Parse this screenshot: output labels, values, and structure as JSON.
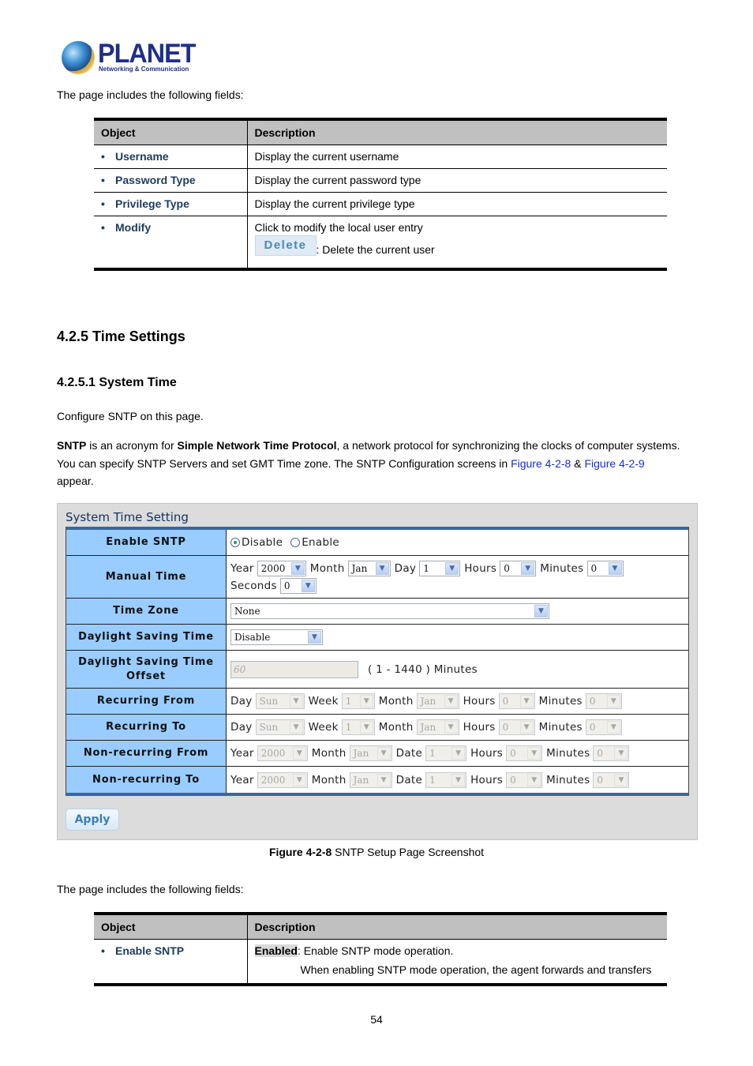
{
  "logo": {
    "brand": "PLANET",
    "tagline": "Networking & Communication"
  },
  "intro1": "The page includes the following fields:",
  "table1": {
    "headers": [
      "Object",
      "Description"
    ],
    "rows": [
      {
        "object": "Username",
        "description": "Display the current username"
      },
      {
        "object": "Password Type",
        "description": "Display the current password type"
      },
      {
        "object": "Privilege Type",
        "description": "Display the current privilege type"
      },
      {
        "object": "Modify",
        "description": "Click to modify the local user entry",
        "button_label": "Delete",
        "button_desc": ": Delete the current user"
      }
    ]
  },
  "section": {
    "h2": "4.2.5 Time Settings",
    "h3": "4.2.5.1 System Time"
  },
  "para1": "Configure SNTP on this page.",
  "para2": {
    "b1": "SNTP",
    "t1": " is an acronym for ",
    "b2": "Simple Network Time Protocol",
    "t2": ", a network protocol for synchronizing the clocks of computer systems.",
    "line2": "You can specify SNTP Servers and set GMT Time zone. The SNTP Configuration screens in ",
    "link1": "Figure 4-2-8",
    "amp": " & ",
    "link2": "Figure 4-2-9",
    "line3": "appear."
  },
  "screenshot": {
    "title": "System Time Setting",
    "enable_sntp": {
      "label": "Enable SNTP",
      "options": [
        "Disable",
        "Enable"
      ],
      "selected": "Disable"
    },
    "manual_time": {
      "label": "Manual Time",
      "year_label": "Year",
      "year": "2000",
      "month_label": "Month",
      "month": "Jan",
      "day_label": "Day",
      "day": "1",
      "hours_label": "Hours",
      "hours": "0",
      "minutes_label": "Minutes",
      "minutes": "0",
      "seconds_label": "Seconds",
      "seconds": "0"
    },
    "time_zone": {
      "label": "Time Zone",
      "value": "None"
    },
    "dst": {
      "label": "Daylight Saving Time",
      "value": "Disable"
    },
    "dst_offset": {
      "label_line1": "Daylight Saving Time",
      "label_line2": "Offset",
      "value": "60",
      "hint": "( 1 - 1440 ) Minutes"
    },
    "recurring_from": {
      "label": "Recurring From",
      "day_label": "Day",
      "day": "Sun",
      "week_label": "Week",
      "week": "1",
      "month_label": "Month",
      "month": "Jan",
      "hours_label": "Hours",
      "hours": "0",
      "minutes_label": "Minutes",
      "minutes": "0"
    },
    "recurring_to": {
      "label": "Recurring To",
      "day_label": "Day",
      "day": "Sun",
      "week_label": "Week",
      "week": "1",
      "month_label": "Month",
      "month": "Jan",
      "hours_label": "Hours",
      "hours": "0",
      "minutes_label": "Minutes",
      "minutes": "0"
    },
    "nonrec_from": {
      "label": "Non-recurring From",
      "year_label": "Year",
      "year": "2000",
      "month_label": "Month",
      "month": "Jan",
      "date_label": "Date",
      "date": "1",
      "hours_label": "Hours",
      "hours": "0",
      "minutes_label": "Minutes",
      "minutes": "0"
    },
    "nonrec_to": {
      "label": "Non-recurring To",
      "year_label": "Year",
      "year": "2000",
      "month_label": "Month",
      "month": "Jan",
      "date_label": "Date",
      "date": "1",
      "hours_label": "Hours",
      "hours": "0",
      "minutes_label": "Minutes",
      "minutes": "0"
    },
    "apply_label": "Apply",
    "colors": {
      "label_bg": "#99ccff",
      "table_rule": "#38679a",
      "title": "#13325a"
    }
  },
  "caption": {
    "bold": "Figure 4-2-8",
    "text": " SNTP Setup Page Screenshot"
  },
  "intro2": "The page includes the following fields:",
  "table2": {
    "headers": [
      "Object",
      "Description"
    ],
    "rows": [
      {
        "object": "Enable SNTP",
        "desc_bold": "Enabled",
        "desc_text": ": Enable SNTP mode operation.",
        "desc_line2": "When enabling SNTP mode operation, the agent forwards and transfers"
      }
    ]
  },
  "page_number": "54"
}
